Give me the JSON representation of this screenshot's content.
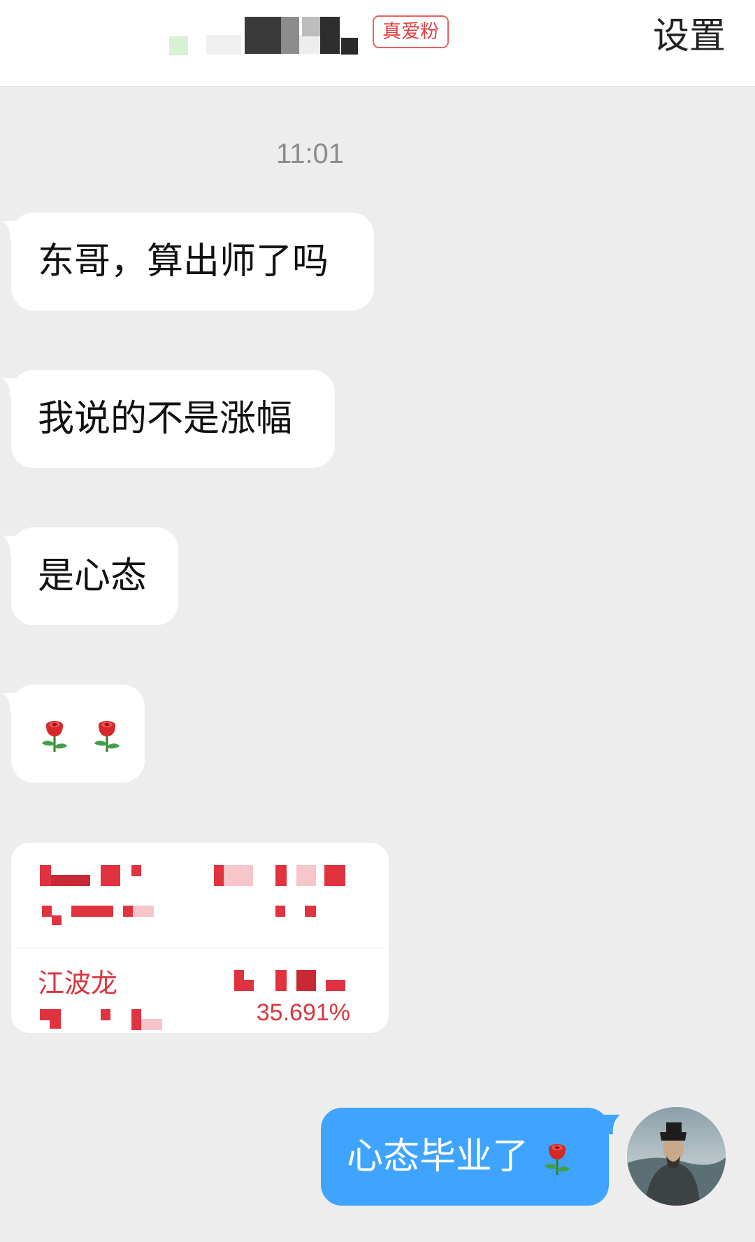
{
  "header": {
    "badge": "真爱粉",
    "settings": "设置"
  },
  "chat": {
    "timestamp": "11:01",
    "incoming": [
      {
        "text": "东哥，算出师了吗"
      },
      {
        "text": "我说的不是涨幅"
      },
      {
        "text": "是心态"
      },
      {
        "text": "",
        "emoji": [
          "rose-icon",
          "rose-icon"
        ]
      }
    ],
    "card": {
      "name": "江波龙",
      "percent": "35.691%"
    },
    "outgoing": {
      "text": "心态毕业了",
      "emoji": "rose-icon"
    }
  },
  "colors": {
    "background": "#ededed",
    "outgoing_bubble": "#3ea4ff",
    "badge_red": "#e0403e",
    "card_red": "#d9363e"
  }
}
